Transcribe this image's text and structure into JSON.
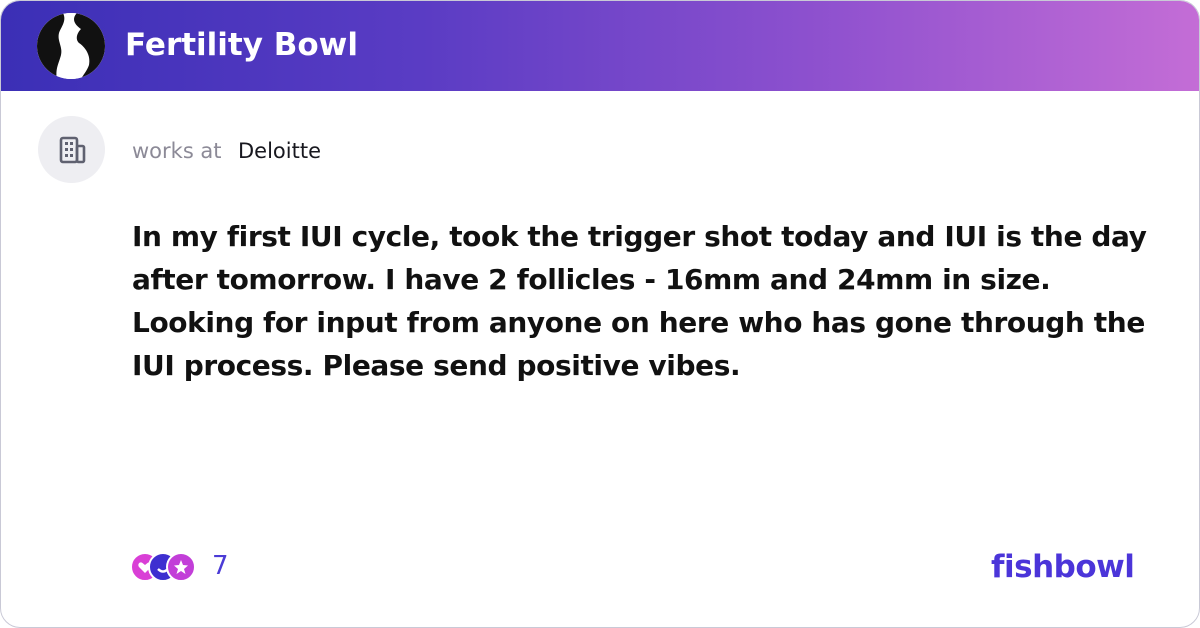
{
  "header": {
    "group_name": "Fertility Bowl",
    "group_icon": "pregnant-silhouette-icon",
    "gradient": [
      "#3b2fb6",
      "#c46dd6"
    ]
  },
  "author": {
    "icon": "building-icon",
    "works_label": "works at",
    "company": "Deloitte"
  },
  "post": {
    "text": "In my first IUI cycle, took the trigger shot today and IUI is the day after tomorrow. I have 2 follicles - 16mm and 24mm in size. Looking for input from anyone on here who has gone through the IUI process. Please send positive vibes."
  },
  "reactions": {
    "icons": [
      "heart-reaction-icon",
      "smile-reaction-icon",
      "star-reaction-icon"
    ],
    "count": "7"
  },
  "brand": {
    "name": "fishbowl",
    "color": "#4b35d9"
  }
}
